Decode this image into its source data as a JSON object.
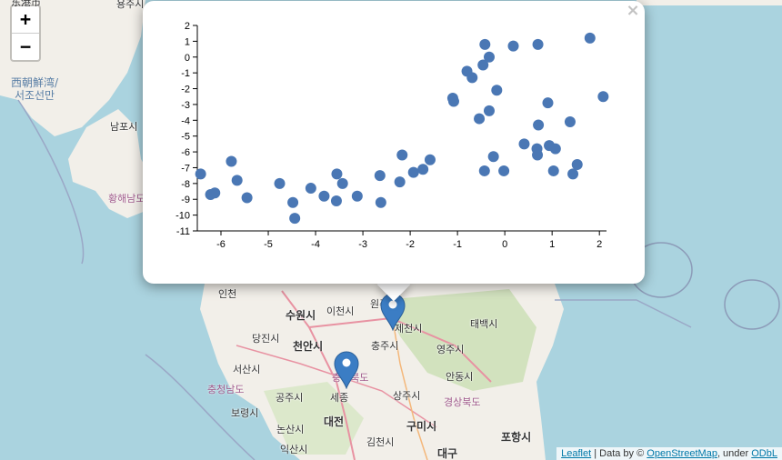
{
  "map": {
    "sea_labels": [
      {
        "text": "西朝鮮湾/\n서조선만",
        "id": "west-korea-bay"
      }
    ],
    "cities": [
      {
        "id": "namposi",
        "text": "남포시"
      },
      {
        "id": "hwanghae",
        "text": "황해남도"
      },
      {
        "id": "incheon",
        "text": "인천"
      },
      {
        "id": "suwon",
        "text": "수원시"
      },
      {
        "id": "icheon",
        "text": "이천시"
      },
      {
        "id": "wonju",
        "text": "원주"
      },
      {
        "id": "jecheon",
        "text": "제천시"
      },
      {
        "id": "taebaek",
        "text": "태백시"
      },
      {
        "id": "dangjin",
        "text": "당진시"
      },
      {
        "id": "cheonan",
        "text": "천안시"
      },
      {
        "id": "chungju",
        "text": "충주시"
      },
      {
        "id": "yeongju",
        "text": "영주시"
      },
      {
        "id": "seosan",
        "text": "서산시"
      },
      {
        "id": "chungbuk",
        "text": "충청북도"
      },
      {
        "id": "chungnam",
        "text": "충청남도"
      },
      {
        "id": "gongju",
        "text": "공주시"
      },
      {
        "id": "sejong",
        "text": "세종"
      },
      {
        "id": "sangju",
        "text": "상주시"
      },
      {
        "id": "andong",
        "text": "안동시"
      },
      {
        "id": "gyeongbuk",
        "text": "경상북도"
      },
      {
        "id": "boryeong",
        "text": "보령시"
      },
      {
        "id": "daejeon",
        "text": "대전"
      },
      {
        "id": "nonsan",
        "text": "논산시"
      },
      {
        "id": "gumi",
        "text": "구미시"
      },
      {
        "id": "pohang",
        "text": "포항시"
      },
      {
        "id": "iksan",
        "text": "익산시"
      },
      {
        "id": "gimcheon",
        "text": "김천시"
      },
      {
        "id": "daegu",
        "text": "대구"
      },
      {
        "id": "top1",
        "text": "东港市"
      },
      {
        "id": "top2",
        "text": "용주시"
      }
    ]
  },
  "zoom": {
    "in_label": "+",
    "out_label": "−"
  },
  "popup": {
    "close_label": "×"
  },
  "attribution": {
    "leaflet": "Leaflet",
    "separator": " | Data by © ",
    "osm": "OpenStreetMap",
    "under": ", under ",
    "odbl": "ODbL"
  },
  "icons": {
    "marker": "map-marker-icon",
    "close": "close-icon"
  },
  "colors": {
    "points": "#4a77b4",
    "marker": "#3b7dc4",
    "land": "#f2efe9",
    "sea": "#aad3df"
  },
  "chart_data": {
    "type": "scatter",
    "title": "",
    "xlabel": "",
    "ylabel": "",
    "xlim": [
      -6.5,
      2.15
    ],
    "ylim": [
      -11,
      2
    ],
    "xticks": [
      -6,
      -5,
      -4,
      -3,
      -2,
      -1,
      0,
      1,
      2
    ],
    "yticks": [
      2,
      1,
      0,
      -1,
      -2,
      -3,
      -4,
      -5,
      -6,
      -7,
      -8,
      -9,
      -10,
      -11
    ],
    "points": [
      [
        -6.43,
        -7.4
      ],
      [
        -6.22,
        -8.7
      ],
      [
        -6.13,
        -8.6
      ],
      [
        -5.78,
        -6.6
      ],
      [
        -5.66,
        -7.8
      ],
      [
        -5.45,
        -8.9
      ],
      [
        -4.76,
        -8.0
      ],
      [
        -4.48,
        -9.2
      ],
      [
        -4.44,
        -10.2
      ],
      [
        -4.1,
        -8.3
      ],
      [
        -3.82,
        -8.8
      ],
      [
        -3.56,
        -9.1
      ],
      [
        -3.55,
        -7.4
      ],
      [
        -3.43,
        -8.0
      ],
      [
        -3.12,
        -8.8
      ],
      [
        -2.64,
        -7.5
      ],
      [
        -2.62,
        -9.2
      ],
      [
        -2.22,
        -7.9
      ],
      [
        -2.17,
        -6.2
      ],
      [
        -1.93,
        -7.3
      ],
      [
        -1.73,
        -7.1
      ],
      [
        -1.58,
        -6.5
      ],
      [
        -1.1,
        -2.6
      ],
      [
        -1.08,
        -2.8
      ],
      [
        -0.8,
        -0.9
      ],
      [
        -0.69,
        -1.3
      ],
      [
        -0.54,
        -3.9
      ],
      [
        -0.46,
        -0.5
      ],
      [
        -0.43,
        -7.2
      ],
      [
        -0.42,
        0.8
      ],
      [
        -0.33,
        0.0
      ],
      [
        -0.33,
        -3.4
      ],
      [
        -0.24,
        -6.3
      ],
      [
        -0.17,
        -2.1
      ],
      [
        -0.02,
        -7.2
      ],
      [
        0.18,
        0.7
      ],
      [
        0.41,
        -5.5
      ],
      [
        0.68,
        -5.8
      ],
      [
        0.69,
        -6.2
      ],
      [
        0.7,
        0.8
      ],
      [
        0.71,
        -4.3
      ],
      [
        0.91,
        -2.9
      ],
      [
        0.94,
        -5.6
      ],
      [
        1.03,
        -7.2
      ],
      [
        1.07,
        -5.8
      ],
      [
        1.38,
        -4.1
      ],
      [
        1.44,
        -7.4
      ],
      [
        1.53,
        -6.8
      ],
      [
        1.8,
        1.2
      ],
      [
        2.08,
        -2.5
      ]
    ]
  }
}
